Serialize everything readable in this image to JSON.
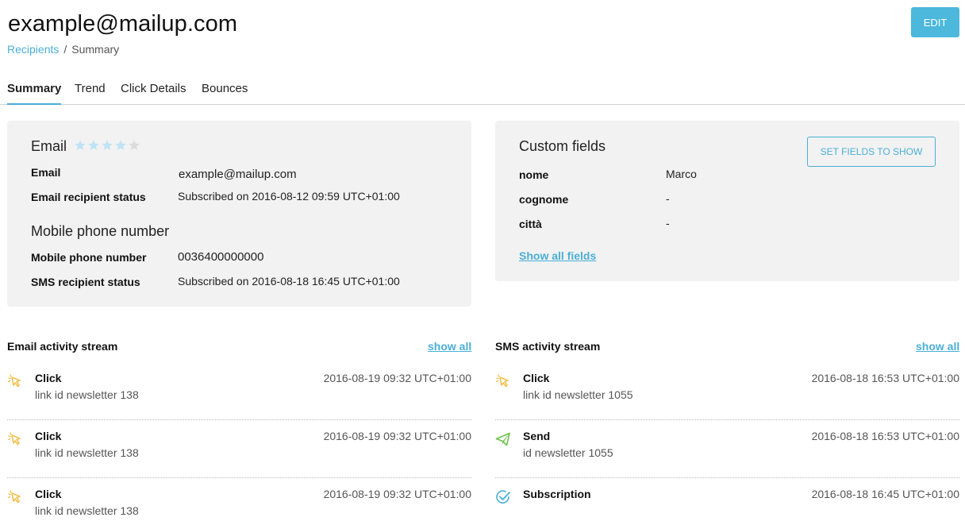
{
  "header": {
    "title": "example@mailup.com",
    "edit_label": "EDIT"
  },
  "breadcrumb": {
    "root": "Recipients",
    "separator": "/",
    "current": "Summary"
  },
  "tabs": [
    {
      "label": "Summary",
      "active": true
    },
    {
      "label": "Trend",
      "active": false
    },
    {
      "label": "Click Details",
      "active": false
    },
    {
      "label": "Bounces",
      "active": false
    }
  ],
  "email_card": {
    "heading": "Email",
    "rating": {
      "value": 4,
      "max": 5
    },
    "rows": [
      {
        "label": "Email",
        "value": "example@mailup.com"
      },
      {
        "label": "Email recipient status",
        "value": "Subscribed on 2016-08-12 09:59 UTC+01:00"
      }
    ],
    "mobile_heading": "Mobile phone number",
    "mobile_rows": [
      {
        "label": "Mobile phone number",
        "value": "0036400000000"
      },
      {
        "label": "SMS recipient status",
        "value": "Subscribed on 2016-08-18 16:45 UTC+01:00"
      }
    ]
  },
  "custom_fields": {
    "heading": "Custom fields",
    "set_button": "SET FIELDS TO SHOW",
    "rows": [
      {
        "label": "nome",
        "value": "Marco"
      },
      {
        "label": "cognome",
        "value": "-"
      },
      {
        "label": "città",
        "value": "-"
      }
    ],
    "show_all": "Show all fields"
  },
  "email_stream": {
    "title": "Email activity stream",
    "show_all": "show all",
    "items": [
      {
        "icon": "click-icon",
        "title": "Click",
        "sub": "link id newsletter 138",
        "time": "2016-08-19 09:32 UTC+01:00"
      },
      {
        "icon": "click-icon",
        "title": "Click",
        "sub": "link id newsletter 138",
        "time": "2016-08-19 09:32 UTC+01:00"
      },
      {
        "icon": "click-icon",
        "title": "Click",
        "sub": "link id newsletter 138",
        "time": "2016-08-19 09:32 UTC+01:00"
      }
    ]
  },
  "sms_stream": {
    "title": "SMS activity stream",
    "show_all": "show all",
    "items": [
      {
        "icon": "click-icon",
        "title": "Click",
        "sub": "link id newsletter 1055",
        "time": "2016-08-18 16:53 UTC+01:00"
      },
      {
        "icon": "send-icon",
        "title": "Send",
        "sub": "id newsletter 1055",
        "time": "2016-08-18 16:53 UTC+01:00"
      },
      {
        "icon": "subscription-icon",
        "title": "Subscription",
        "sub": "",
        "time": "2016-08-18 16:45 UTC+01:00"
      }
    ]
  },
  "colors": {
    "accent": "#4cb8dc",
    "click_icon": "#f2c14e",
    "send_icon": "#6cc04a",
    "subscription_icon": "#4aafd6",
    "star_on": "#bfe3f5",
    "star_off": "#dcdcdc"
  }
}
